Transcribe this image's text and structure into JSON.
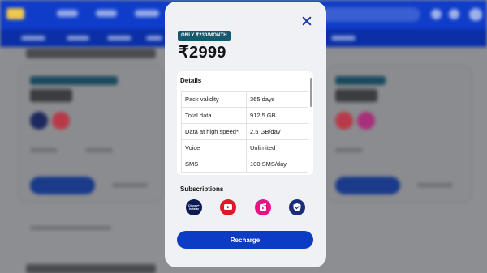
{
  "plan": {
    "badge": "ONLY ₹230/MONTH",
    "price": "₹2999"
  },
  "details": {
    "title": "Details",
    "rows": [
      {
        "label": "Pack validity",
        "value": "365 days"
      },
      {
        "label": "Total data",
        "value": "912.5 GB"
      },
      {
        "label": "Data at high speed*",
        "value": "2.5 GB/day"
      },
      {
        "label": "Voice",
        "value": "Unlimited"
      },
      {
        "label": "SMS",
        "value": "100 SMS/day"
      }
    ]
  },
  "subscriptions": {
    "title": "Subscriptions",
    "items": [
      {
        "icon": "disney-hotstar-icon",
        "text": "Disney+ hotstar",
        "color": "#0b1a55"
      },
      {
        "icon": "jiotv-icon",
        "color": "#e0182a"
      },
      {
        "icon": "jiocinema-icon",
        "color": "#e0158a"
      },
      {
        "icon": "jiosecurity-icon",
        "color": "#1b2c7a"
      }
    ]
  },
  "actions": {
    "recharge_label": "Recharge"
  },
  "colors": {
    "brand_blue": "#0d3cc4",
    "badge_teal": "#14596e"
  }
}
